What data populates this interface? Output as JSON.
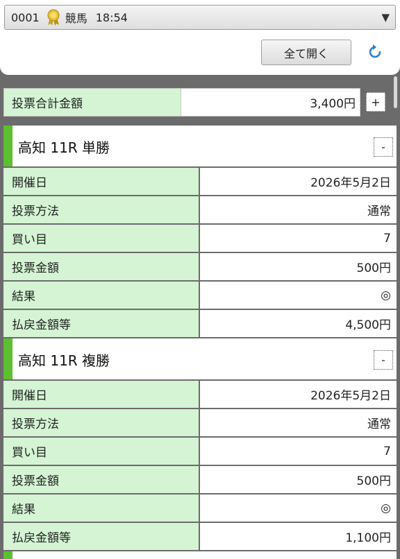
{
  "header": {
    "select_id": "0001",
    "select_category": "競馬",
    "select_time": "18:54",
    "open_all_label": "全て開く"
  },
  "total": {
    "label": "投票合計金額",
    "value": "3,400円",
    "toggle": "+"
  },
  "sections": [
    {
      "title": "高知 11R 単勝",
      "toggle": "-",
      "rows": [
        {
          "k": "開催日",
          "v": "2026年5月2日"
        },
        {
          "k": "投票方法",
          "v": "通常"
        },
        {
          "k": "買い目",
          "v": "7"
        },
        {
          "k": "投票金額",
          "v": "500円"
        },
        {
          "k": "結果",
          "v": "◎"
        },
        {
          "k": "払戻金額等",
          "v": "4,500円"
        }
      ]
    },
    {
      "title": "高知 11R 複勝",
      "toggle": "-",
      "rows": [
        {
          "k": "開催日",
          "v": "2026年5月2日"
        },
        {
          "k": "投票方法",
          "v": "通常"
        },
        {
          "k": "買い目",
          "v": "7"
        },
        {
          "k": "投票金額",
          "v": "500円"
        },
        {
          "k": "結果",
          "v": "◎"
        },
        {
          "k": "払戻金額等",
          "v": "1,100円"
        }
      ]
    }
  ],
  "colors": {
    "accent_green": "#5cbf31",
    "label_bg": "#d4f4d4",
    "refresh_blue": "#2a7fd0"
  },
  "icons": {
    "medal": "medal-icon",
    "refresh": "refresh-icon",
    "dropdown": "dropdown-arrow-icon"
  }
}
